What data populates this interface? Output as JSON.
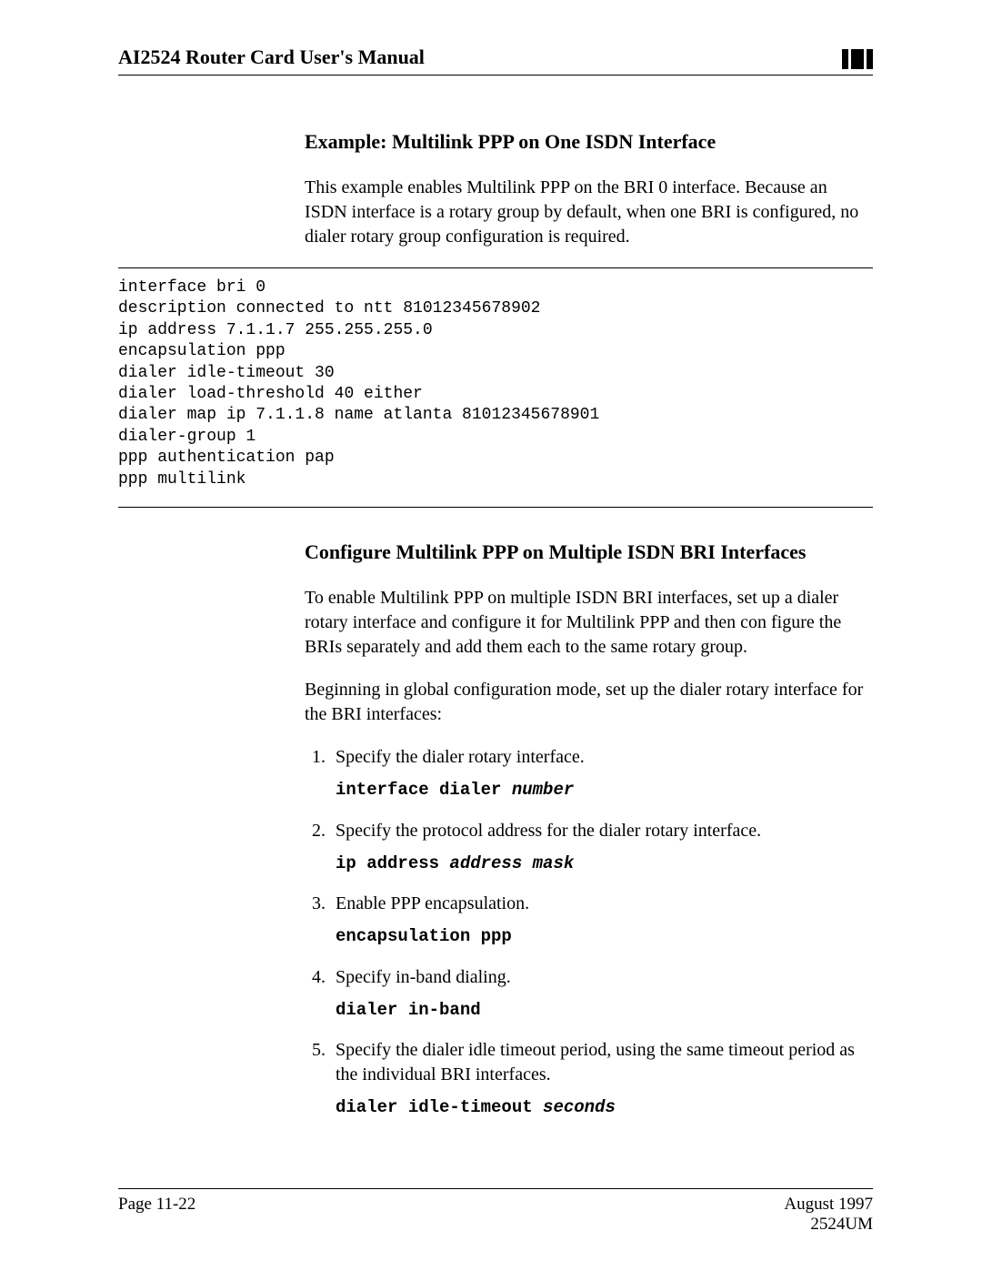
{
  "header": {
    "title": "AI2524 Router Card User's Manual"
  },
  "section1": {
    "heading": "Example: Multilink PPP on One ISDN Interface",
    "para": "This example enables Multilink PPP on the BRI 0 interface. Because an ISDN interface is a rotary group by default, when one BRI is configured, no dialer rotary group configuration is required."
  },
  "code": "interface bri 0\ndescription connected to ntt 81012345678902\nip address 7.1.1.7 255.255.255.0\nencapsulation ppp\ndialer idle-timeout 30\ndialer load-threshold 40 either\ndialer map ip 7.1.1.8 name atlanta 81012345678901\ndialer-group 1\nppp authentication pap\nppp multilink",
  "section2": {
    "heading": "Configure Multilink PPP on Multiple ISDN BRI Interfaces",
    "para1": "To enable Multilink PPP on multiple ISDN BRI interfaces, set up a dialer rotary interface and configure it for Multilink PPP and then con figure the BRIs separately and add them each to the same rotary group.",
    "para2": "Beginning in global configuration mode, set up the dialer rotary interface for the BRI interfaces:",
    "steps": [
      {
        "text": "Specify the dialer rotary interface.",
        "cmd_prefix": "interface dialer ",
        "cmd_arg": "number"
      },
      {
        "text": "Specify the protocol address for the dialer rotary interface.",
        "cmd_prefix": "ip address ",
        "cmd_arg": "address mask"
      },
      {
        "text": "Enable PPP encapsulation.",
        "cmd_prefix": "encapsulation ppp",
        "cmd_arg": ""
      },
      {
        "text": "Specify in-band dialing.",
        "cmd_prefix": "dialer in-band",
        "cmd_arg": ""
      },
      {
        "text": "Specify the dialer idle timeout period, using the same timeout period as the individual BRI interfaces.",
        "cmd_prefix": "dialer idle-timeout ",
        "cmd_arg": "seconds"
      }
    ]
  },
  "footer": {
    "page": "Page 11-22",
    "date": "August 1997",
    "doc": "2524UM"
  }
}
